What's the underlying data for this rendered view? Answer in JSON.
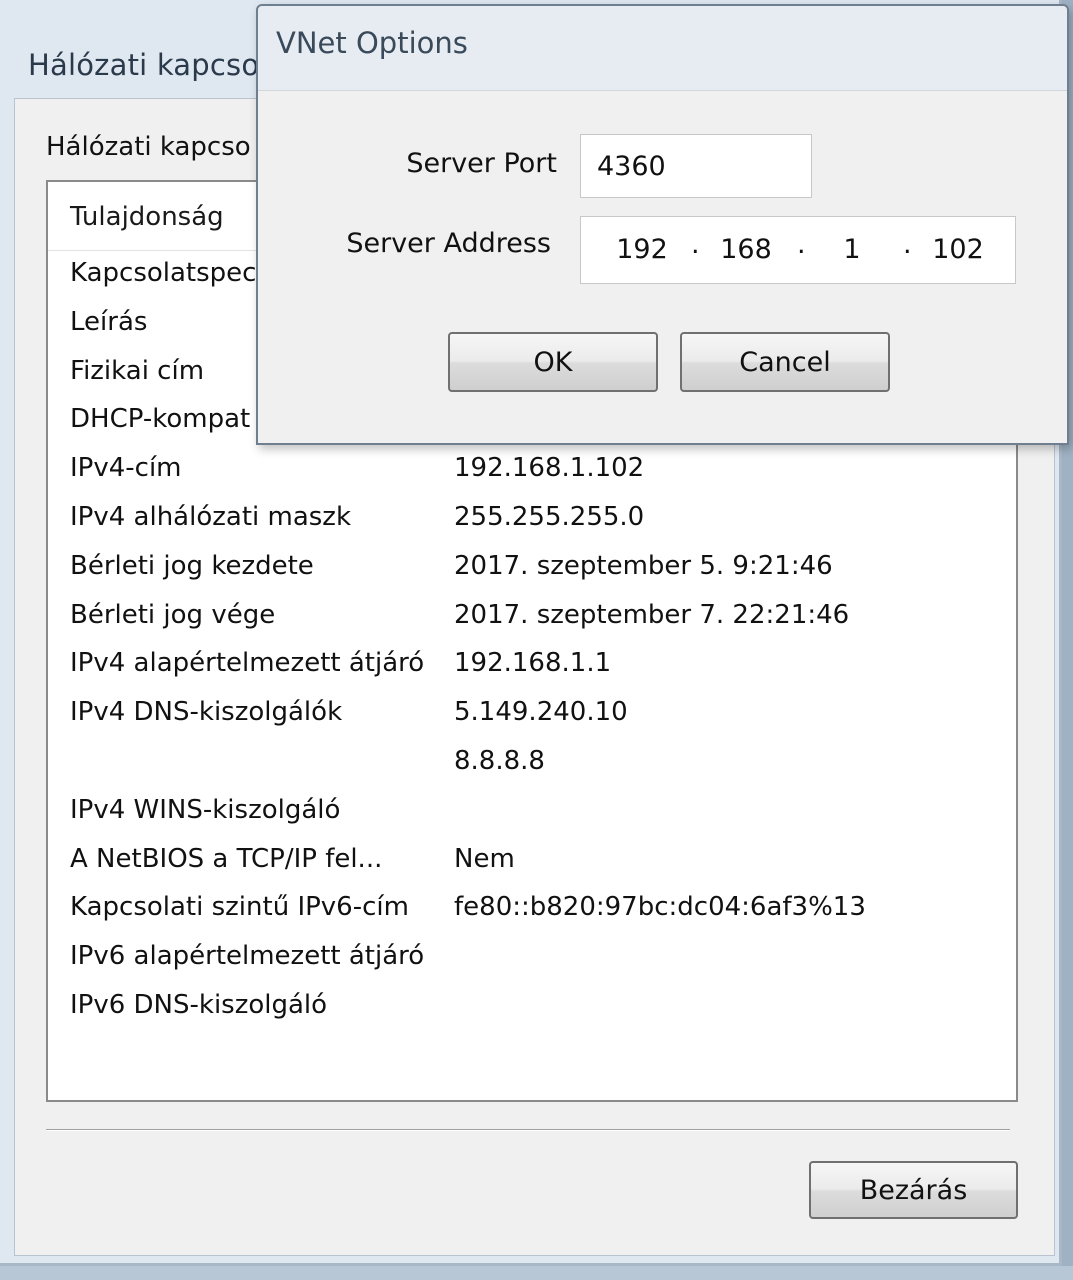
{
  "back_window": {
    "title": "Hálózati kapcso",
    "group_label": "Hálózati kapcso",
    "list": {
      "header": "Tulajdonság",
      "rows": [
        {
          "prop": "Kapcsolatspec",
          "val": ""
        },
        {
          "prop": "Leírás",
          "val": ""
        },
        {
          "prop": "Fizikai cím",
          "val": ""
        },
        {
          "prop": "DHCP-kompat",
          "val": ""
        },
        {
          "prop": "IPv4-cím",
          "val": "192.168.1.102"
        },
        {
          "prop": "IPv4 alhálózati maszk",
          "val": "255.255.255.0"
        },
        {
          "prop": "Bérleti jog kezdete",
          "val": "2017. szeptember 5. 9:21:46"
        },
        {
          "prop": "Bérleti jog vége",
          "val": "2017. szeptember 7. 22:21:46"
        },
        {
          "prop": "IPv4 alapértelmezett átjáró",
          "val": "192.168.1.1"
        },
        {
          "prop": "IPv4 DNS-kiszolgálók",
          "val": "5.149.240.10"
        },
        {
          "prop": "",
          "val": "8.8.8.8"
        },
        {
          "prop": "IPv4 WINS-kiszolgáló",
          "val": ""
        },
        {
          "prop": "A NetBIOS a TCP/IP fel...",
          "val": "Nem"
        },
        {
          "prop": "Kapcsolati szintű IPv6-cím",
          "val": "fe80::b820:97bc:dc04:6af3%13"
        },
        {
          "prop": "IPv6 alapértelmezett átjáró",
          "val": ""
        },
        {
          "prop": "IPv6 DNS-kiszolgáló",
          "val": ""
        }
      ]
    },
    "close_button": "Bezárás"
  },
  "dialog": {
    "title": "VNet Options",
    "server_port_label": "Server Port",
    "server_port_value": "4360",
    "server_address_label": "Server Address",
    "server_address": [
      "192",
      "168",
      "1",
      "102"
    ],
    "ip_separator": ".",
    "ok_button": "OK",
    "cancel_button": "Cancel"
  }
}
